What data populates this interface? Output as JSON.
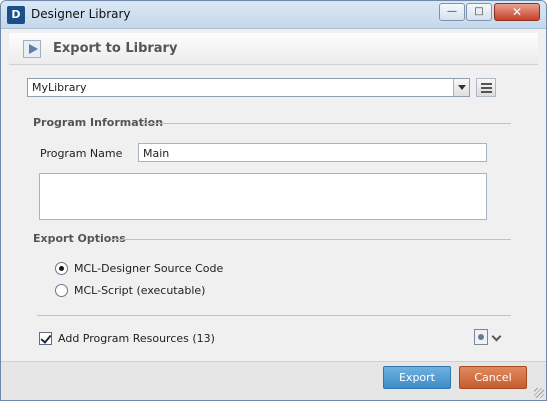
{
  "window": {
    "title": "Designer Library",
    "icon_letter": "D"
  },
  "header": {
    "title": "Export to Library"
  },
  "library": {
    "selected": "MyLibrary"
  },
  "program_info": {
    "heading": "Program Information",
    "name_label": "Program Name",
    "name_value": "Main",
    "description": ""
  },
  "export_options": {
    "heading": "Export Options",
    "options": [
      {
        "label": "MCL-Designer Source Code",
        "checked": true
      },
      {
        "label": "MCL-Script (executable)",
        "checked": false
      }
    ]
  },
  "resources": {
    "label": "Add Program Resources (13)",
    "checked": true
  },
  "buttons": {
    "export": "Export",
    "cancel": "Cancel"
  }
}
